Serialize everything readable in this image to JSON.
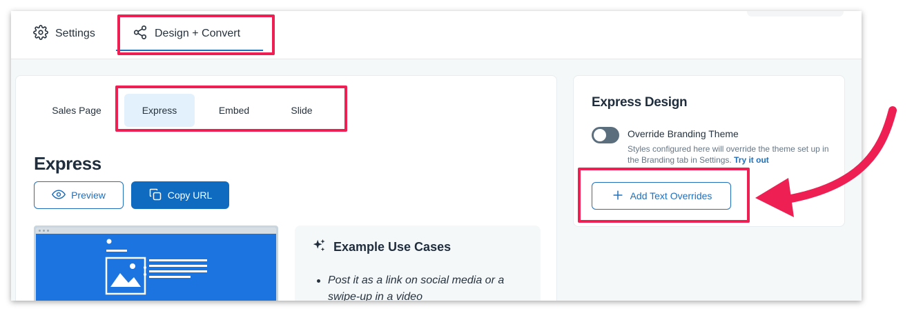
{
  "topbar": {
    "tabs": [
      {
        "label": "Settings",
        "icon": "gear-icon"
      },
      {
        "label": "Design + Convert",
        "icon": "share-icon"
      }
    ]
  },
  "subtabs": [
    "Sales Page",
    "Express",
    "Embed",
    "Slide"
  ],
  "main": {
    "heading": "Express",
    "preview_label": "Preview",
    "copy_url_label": "Copy URL",
    "use_cases": {
      "title": "Example Use Cases",
      "items": [
        "Post it as a link on social media or a swipe-up in a video"
      ]
    }
  },
  "express_design": {
    "title": "Express Design",
    "toggle_label": "Override Branding Theme",
    "toggle_state": "off",
    "help_text": "Styles configured here will override the theme set up in the Branding tab in Settings.",
    "help_link": "Try it out",
    "add_overrides_label": "Add Text Overrides"
  },
  "colors": {
    "accent": "#1f6fbd",
    "primary_button": "#0e6bc0",
    "highlight": "#ee1f52",
    "active_subtab": "#e2f1fb"
  }
}
